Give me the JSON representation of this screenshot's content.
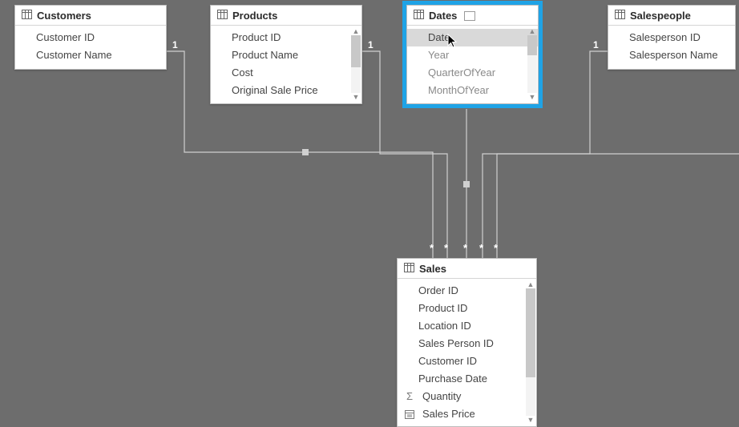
{
  "tables": {
    "customers": {
      "title": "Customers",
      "fields": [
        "Customer ID",
        "Customer Name"
      ]
    },
    "products": {
      "title": "Products",
      "fields": [
        "Product ID",
        "Product Name",
        "Cost",
        "Original Sale Price"
      ]
    },
    "dates": {
      "title": "Dates",
      "fields": [
        "Date",
        "Year",
        "QuarterOfYear",
        "MonthOfYear"
      ]
    },
    "salespeople": {
      "title": "Salespeople",
      "fields": [
        "Salesperson ID",
        "Salesperson Name"
      ]
    },
    "sales": {
      "title": "Sales",
      "fields": [
        {
          "name": "Order ID"
        },
        {
          "name": "Product ID"
        },
        {
          "name": "Location ID"
        },
        {
          "name": "Sales Person ID"
        },
        {
          "name": "Customer ID"
        },
        {
          "name": "Purchase Date"
        },
        {
          "name": "Quantity",
          "icon": "sigma"
        },
        {
          "name": "Sales Price",
          "icon": "number"
        }
      ]
    }
  },
  "relationships": {
    "one_label": "1",
    "many_label": "*"
  }
}
